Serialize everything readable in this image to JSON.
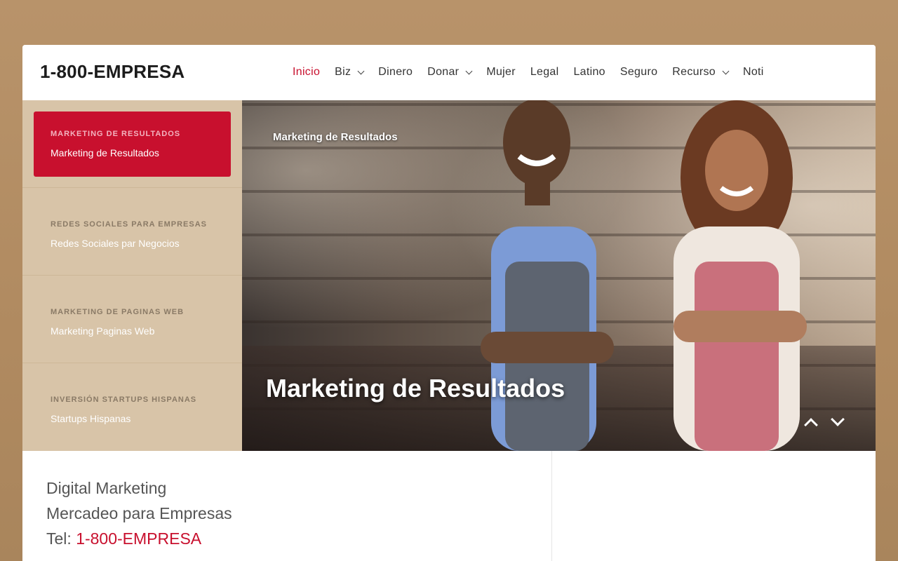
{
  "header": {
    "logo": "1-800-EMPRESA",
    "nav": [
      {
        "label": "Inicio",
        "active": true,
        "dropdown": false
      },
      {
        "label": "Biz",
        "active": false,
        "dropdown": true
      },
      {
        "label": "Dinero",
        "active": false,
        "dropdown": false
      },
      {
        "label": "Donar",
        "active": false,
        "dropdown": true
      },
      {
        "label": "Mujer",
        "active": false,
        "dropdown": false
      },
      {
        "label": "Legal",
        "active": false,
        "dropdown": false
      },
      {
        "label": "Latino",
        "active": false,
        "dropdown": false
      },
      {
        "label": "Seguro",
        "active": false,
        "dropdown": false
      },
      {
        "label": "Recurso",
        "active": false,
        "dropdown": true
      },
      {
        "label": "Noti",
        "active": false,
        "dropdown": false
      }
    ]
  },
  "slider": {
    "tabs": [
      {
        "kicker": "MARKETING DE RESULTADOS",
        "title": "Marketing de Resultados",
        "active": true
      },
      {
        "kicker": "REDES SOCIALES PARA EMPRESAS",
        "title": "Redes Sociales par Negocios",
        "active": false
      },
      {
        "kicker": "MARKETING DE PAGINAS WEB",
        "title": "Marketing Paginas Web",
        "active": false
      },
      {
        "kicker": "INVERSIÓN STARTUPS HISPANAS",
        "title": "Startups Hispanas",
        "active": false
      }
    ],
    "slide": {
      "kicker": "Marketing de Resultados",
      "title": "Marketing de Resultados"
    },
    "controls": {
      "prev_icon": "chevron-up-icon",
      "next_icon": "chevron-down-icon"
    }
  },
  "content": {
    "line1": "Digital Marketing",
    "line2": "Mercadeo para Empresas",
    "tel_label": "Tel: ",
    "tel_value": "1-800-EMPRESA"
  },
  "colors": {
    "accent": "#c8102e",
    "tabs_bg": "#d8c4a8",
    "page_bg": "#b38d62"
  }
}
